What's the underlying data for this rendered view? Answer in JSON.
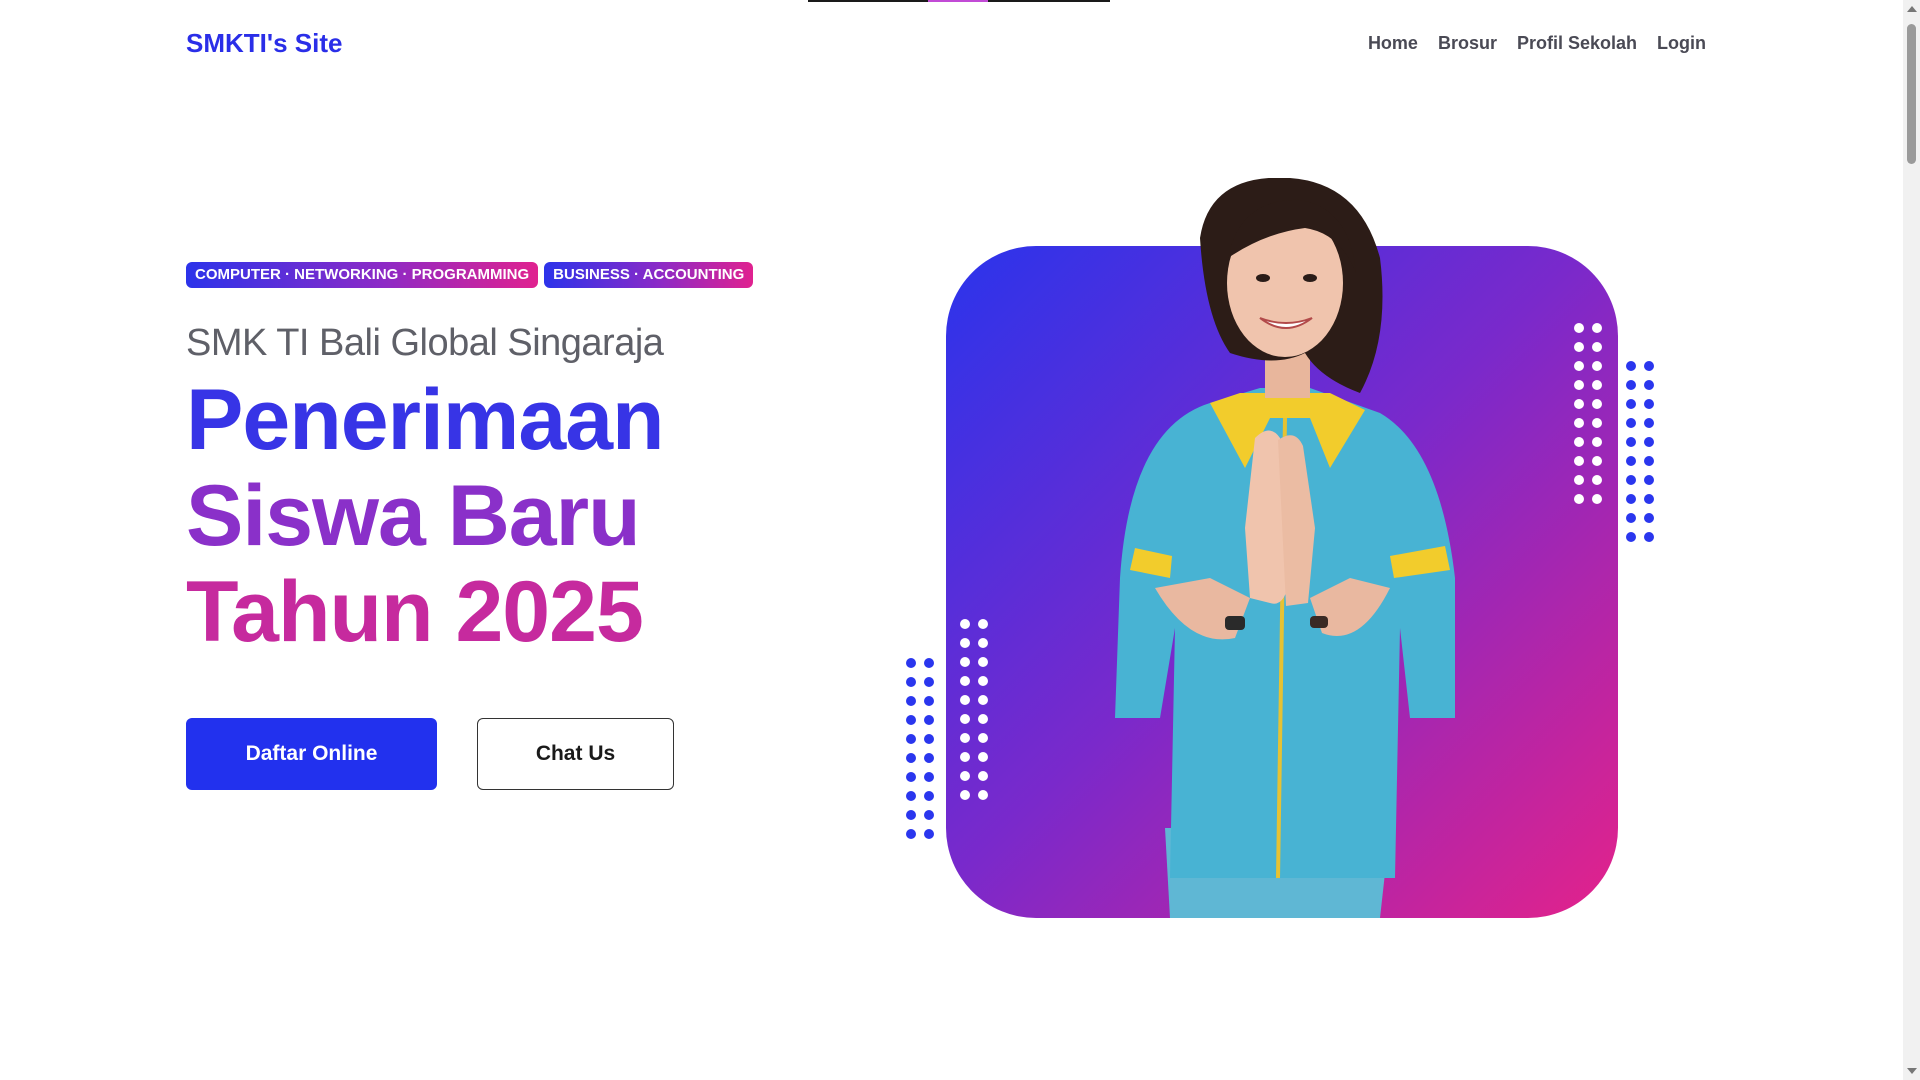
{
  "header": {
    "brand": "SMKTI's Site",
    "nav": [
      "Home",
      "Brosur",
      "Profil Sekolah",
      "Login"
    ]
  },
  "hero": {
    "tags": [
      "COMPUTER · NETWORKING · PROGRAMMING",
      "BUSINESS · ACCOUNTING"
    ],
    "subtitle": "SMK TI Bali Global Singaraja",
    "headline": [
      "Penerimaan",
      "Siswa Baru",
      "Tahun 2025"
    ],
    "primary_button": "Daftar Online",
    "secondary_button": "Chat Us"
  },
  "colors": {
    "brand_blue": "#2a2ee8",
    "button_blue": "#2231ee",
    "gradient_start": "#2a34ec",
    "gradient_mid": "#7a29cb",
    "gradient_end": "#e4228a"
  },
  "icons": [
    "scroll-up-arrow-icon",
    "scroll-down-arrow-icon"
  ]
}
